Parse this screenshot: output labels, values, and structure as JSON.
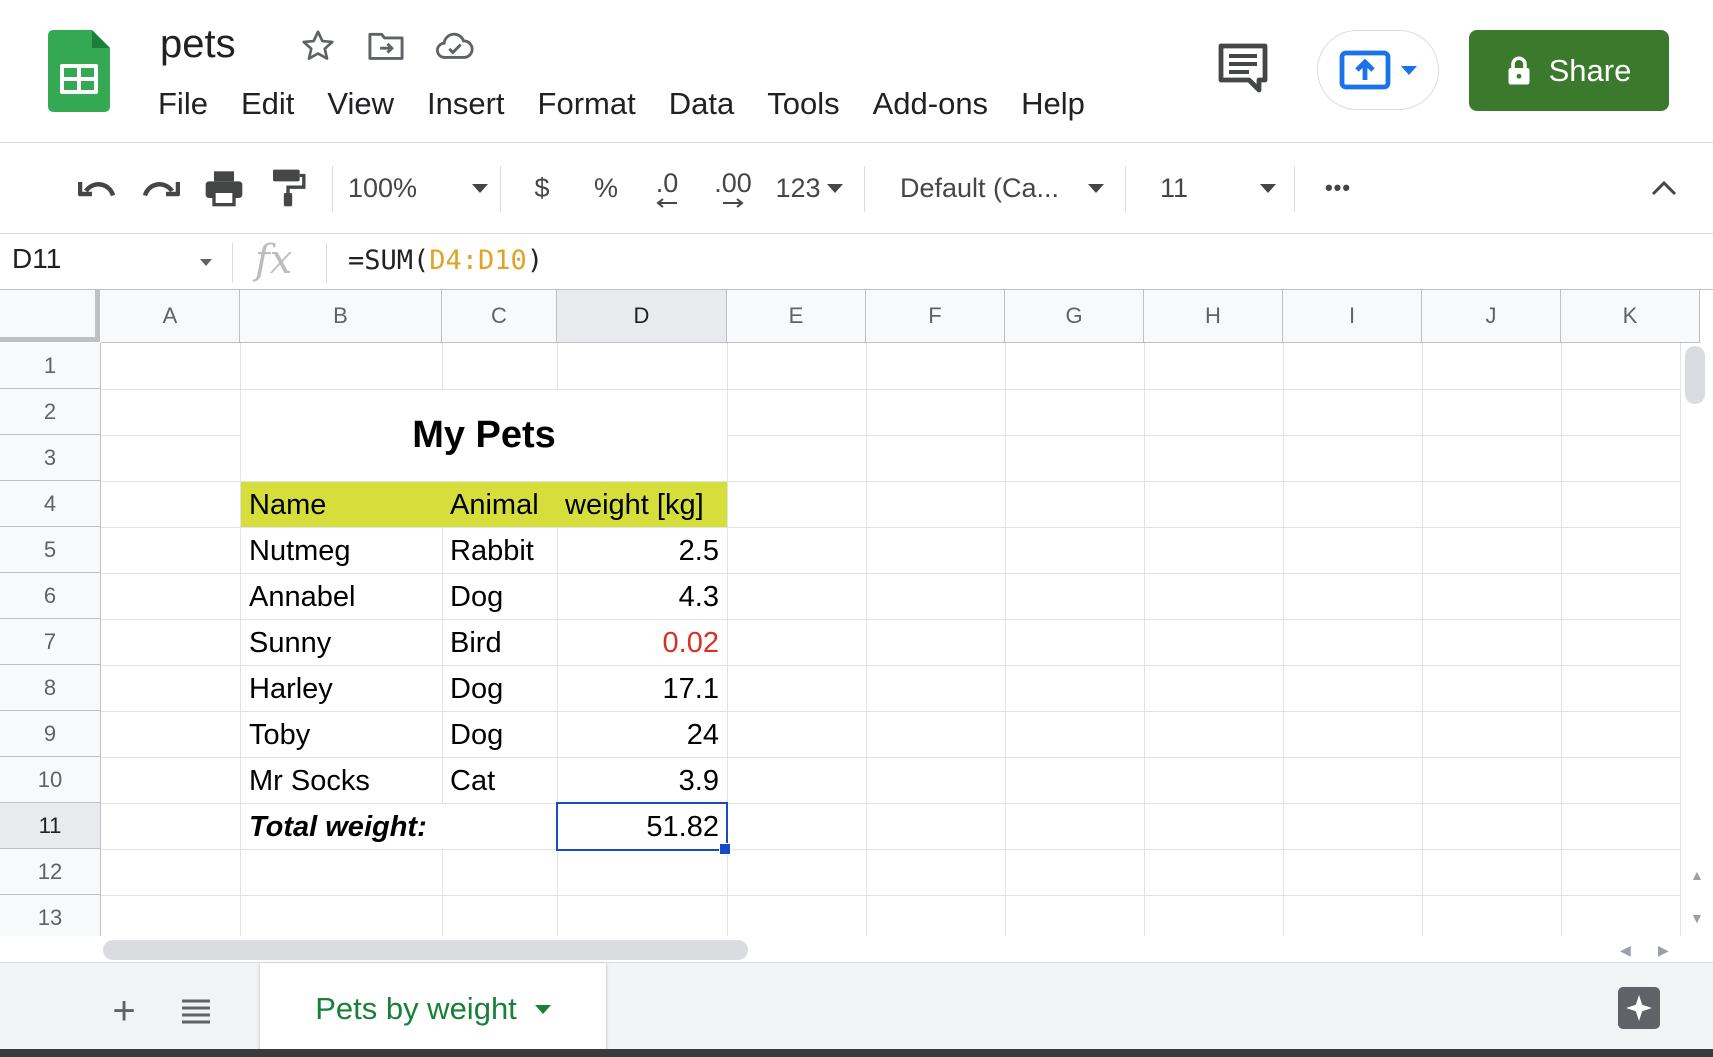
{
  "app": {
    "doc_title": "pets",
    "menu": [
      "File",
      "Edit",
      "View",
      "Insert",
      "Format",
      "Data",
      "Tools",
      "Add-ons",
      "Help"
    ],
    "share_label": "Share",
    "brand_color": "#3b7a2c"
  },
  "toolbar": {
    "zoom": "100%",
    "currency": "$",
    "percent": "%",
    "decrease_decimals": ".0",
    "increase_decimals": ".00",
    "more_formats": "123",
    "font": "Default (Ca...",
    "font_size": "11",
    "more": "•••"
  },
  "formula_bar": {
    "cell_ref": "D11",
    "fx": "fx",
    "formula_prefix": "=SUM(",
    "formula_ref": "D4:D10",
    "formula_suffix": ")"
  },
  "grid": {
    "columns": [
      "A",
      "B",
      "C",
      "D",
      "E",
      "F",
      "G",
      "H",
      "I",
      "J",
      "K"
    ],
    "rows": [
      "1",
      "2",
      "3",
      "4",
      "5",
      "6",
      "7",
      "8",
      "9",
      "10",
      "11",
      "12",
      "13"
    ],
    "selected_column": "D",
    "selected_row": "11"
  },
  "sheet": {
    "title": "My Pets",
    "headers": [
      "Name",
      "Animal",
      "weight [kg]"
    ],
    "header_color": "#d6de3c",
    "rows": [
      {
        "name": "Nutmeg",
        "animal": "Rabbit",
        "weight": "2.5"
      },
      {
        "name": "Annabel",
        "animal": "Dog",
        "weight": "4.3"
      },
      {
        "name": "Sunny",
        "animal": "Bird",
        "weight": "0.02"
      },
      {
        "name": "Harley",
        "animal": "Dog",
        "weight": "17.1"
      },
      {
        "name": "Toby",
        "animal": "Dog",
        "weight": "24"
      },
      {
        "name": "Mr Socks",
        "animal": "Cat",
        "weight": "3.9"
      }
    ],
    "highlight_color": "#d93025",
    "total_label": "Total weight:",
    "total_value": "51.82"
  },
  "tabs": {
    "active_sheet": "Pets by weight",
    "add_icon": "+",
    "all_sheets_icon": "≡"
  }
}
